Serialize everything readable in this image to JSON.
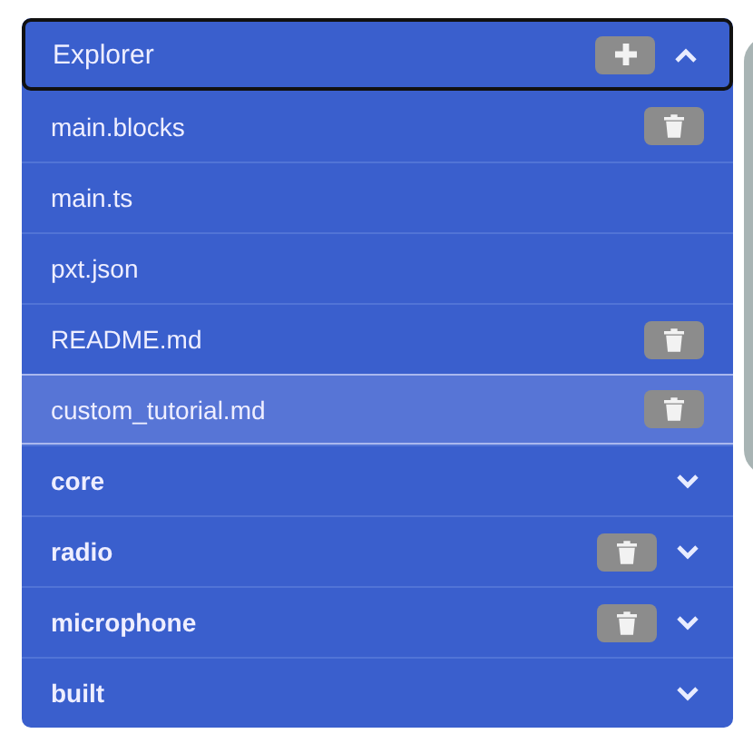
{
  "explorer": {
    "title": "Explorer",
    "expanded": true
  },
  "files": [
    {
      "name": "main.blocks",
      "deletable": true,
      "selected": false
    },
    {
      "name": "main.ts",
      "deletable": false,
      "selected": false
    },
    {
      "name": "pxt.json",
      "deletable": false,
      "selected": false
    },
    {
      "name": "README.md",
      "deletable": true,
      "selected": false
    },
    {
      "name": "custom_tutorial.md",
      "deletable": true,
      "selected": true
    }
  ],
  "packages": [
    {
      "name": "core",
      "deletable": false,
      "expanded": false
    },
    {
      "name": "radio",
      "deletable": true,
      "expanded": false
    },
    {
      "name": "microphone",
      "deletable": true,
      "expanded": false
    },
    {
      "name": "built",
      "deletable": false,
      "expanded": false
    }
  ]
}
